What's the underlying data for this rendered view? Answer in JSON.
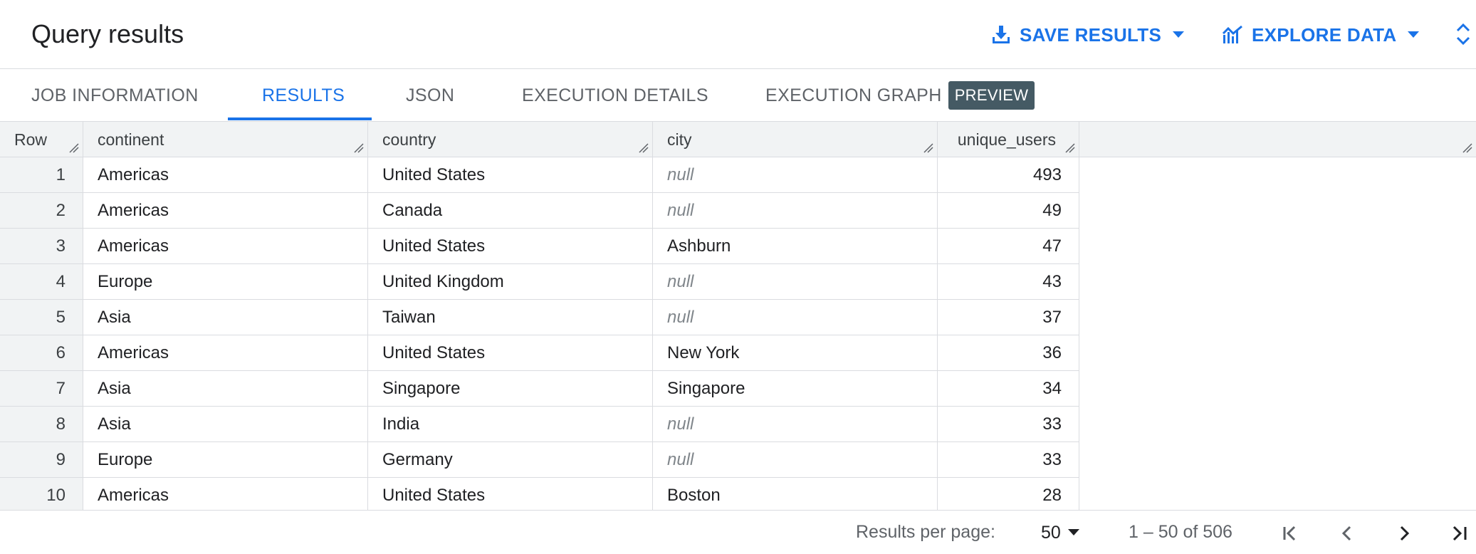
{
  "header": {
    "title": "Query results",
    "save_results_label": "SAVE RESULTS",
    "explore_data_label": "EXPLORE DATA"
  },
  "tabs": [
    {
      "label": "JOB INFORMATION",
      "active": false
    },
    {
      "label": "RESULTS",
      "active": true
    },
    {
      "label": "JSON",
      "active": false
    },
    {
      "label": "EXECUTION DETAILS",
      "active": false
    },
    {
      "label": "EXECUTION GRAPH",
      "active": false,
      "badge": "PREVIEW"
    }
  ],
  "table": {
    "columns": [
      "Row",
      "continent",
      "country",
      "city",
      "unique_users"
    ],
    "rows": [
      {
        "row": "1",
        "continent": "Americas",
        "country": "United States",
        "city": "null",
        "unique_users": "493"
      },
      {
        "row": "2",
        "continent": "Americas",
        "country": "Canada",
        "city": "null",
        "unique_users": "49"
      },
      {
        "row": "3",
        "continent": "Americas",
        "country": "United States",
        "city": "Ashburn",
        "unique_users": "47"
      },
      {
        "row": "4",
        "continent": "Europe",
        "country": "United Kingdom",
        "city": "null",
        "unique_users": "43"
      },
      {
        "row": "5",
        "continent": "Asia",
        "country": "Taiwan",
        "city": "null",
        "unique_users": "37"
      },
      {
        "row": "6",
        "continent": "Americas",
        "country": "United States",
        "city": "New York",
        "unique_users": "36"
      },
      {
        "row": "7",
        "continent": "Asia",
        "country": "Singapore",
        "city": "Singapore",
        "unique_users": "34"
      },
      {
        "row": "8",
        "continent": "Asia",
        "country": "India",
        "city": "null",
        "unique_users": "33"
      },
      {
        "row": "9",
        "continent": "Europe",
        "country": "Germany",
        "city": "null",
        "unique_users": "33"
      },
      {
        "row": "10",
        "continent": "Americas",
        "country": "United States",
        "city": "Boston",
        "unique_users": "28"
      }
    ]
  },
  "footer": {
    "per_page_label": "Results per page:",
    "per_page_value": "50",
    "range_text": "1 – 50 of 506"
  },
  "colors": {
    "accent": "#1a73e8",
    "badge_bg": "#455a64",
    "header_bg": "#f1f3f4"
  },
  "icons": {
    "save": "download-icon",
    "explore": "chart-icon",
    "expand": "unfold-icon",
    "first": "first-page-icon",
    "prev": "chevron-left-icon",
    "next": "chevron-right-icon",
    "last": "last-page-icon"
  }
}
